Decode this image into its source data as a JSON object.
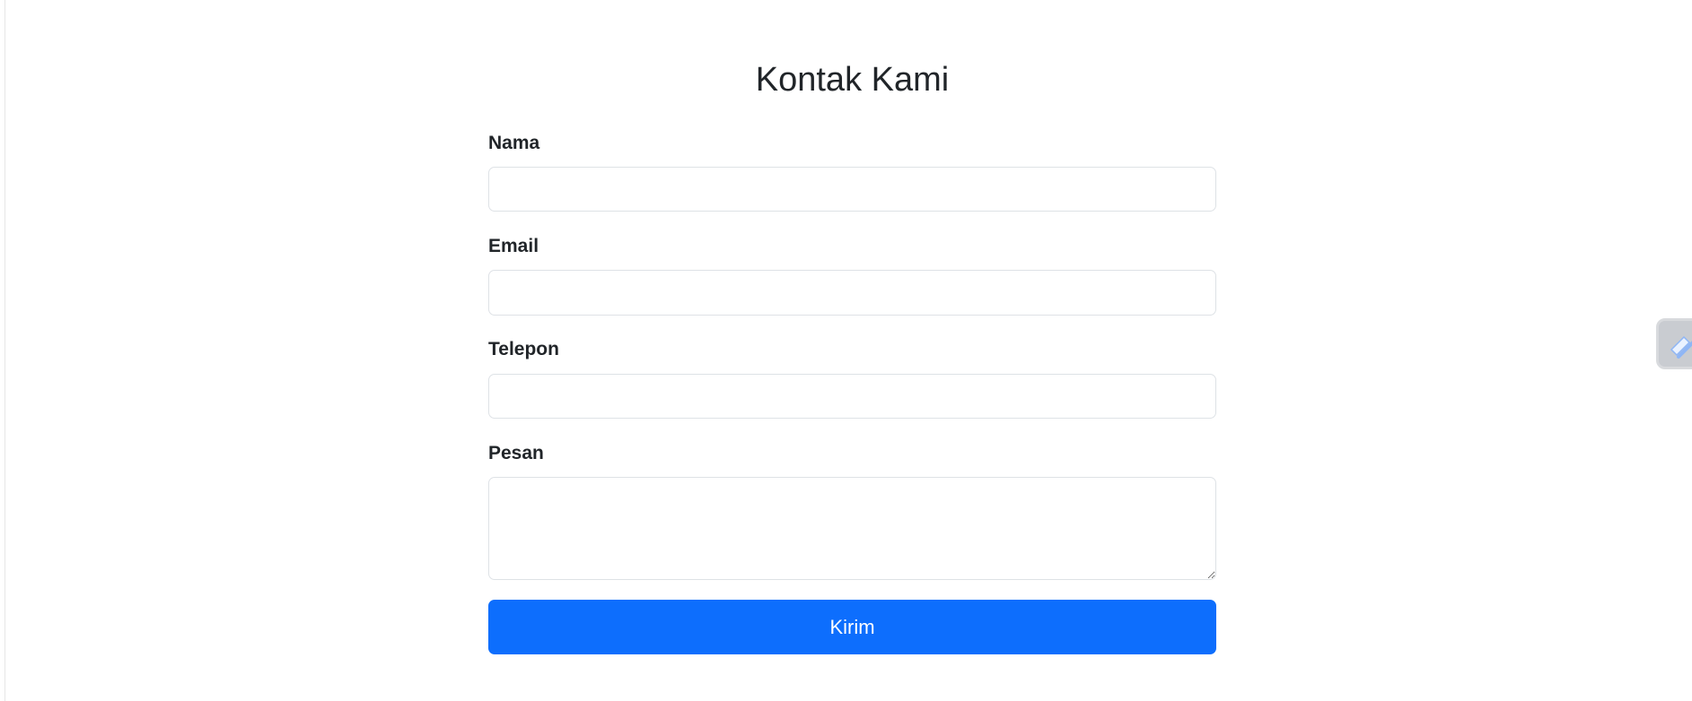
{
  "form": {
    "title": "Kontak Kami",
    "fields": [
      {
        "label": "Nama",
        "value": "",
        "placeholder": ""
      },
      {
        "label": "Email",
        "value": "",
        "placeholder": ""
      },
      {
        "label": "Telepon",
        "value": "",
        "placeholder": ""
      },
      {
        "label": "Pesan",
        "value": "",
        "placeholder": ""
      }
    ],
    "submit_label": "Kirim"
  },
  "colors": {
    "primary": "#0d6efd",
    "text": "#212529",
    "border": "#dee2e6"
  },
  "icons": {
    "side_widget": "pen-icon"
  }
}
